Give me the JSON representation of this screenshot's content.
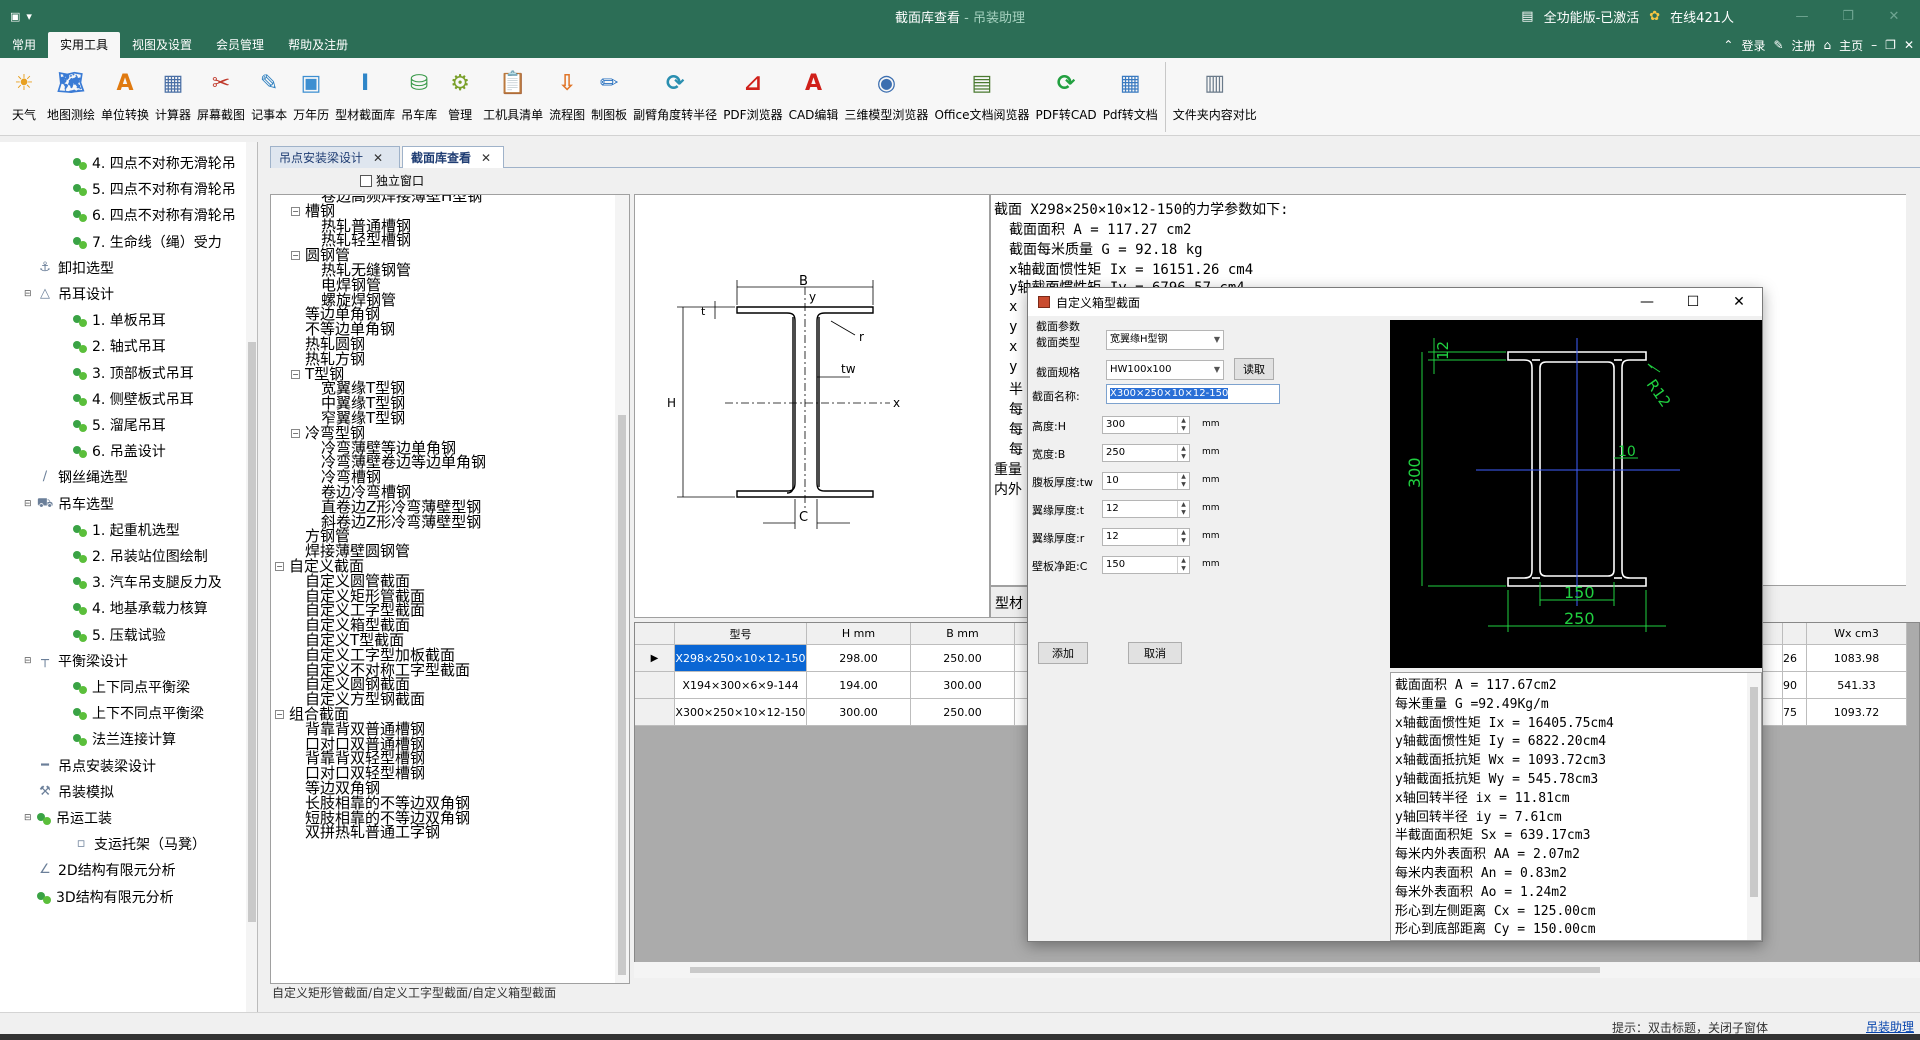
{
  "window": {
    "title": "截面库查看",
    "separator": " - ",
    "app_name": "吊装助理",
    "edition_badge": "全功能版-已激活",
    "online": "在线421人"
  },
  "menu": {
    "tabs": [
      "常用",
      "实用工具",
      "视图及设置",
      "会员管理",
      "帮助及注册"
    ],
    "active_tab": "实用工具",
    "right": {
      "login": "登录",
      "register": "注册",
      "home": "主页"
    }
  },
  "ribbon": {
    "items": [
      {
        "label": "天气",
        "icon": "weather-icon",
        "glyph": "☀",
        "color": "#e8a020"
      },
      {
        "label": "地图测绘",
        "icon": "map-icon",
        "glyph": "🗺",
        "color": "#3a7bd5"
      },
      {
        "label": "单位转换",
        "icon": "unit-convert-icon",
        "glyph": "A",
        "color": "#e07a10"
      },
      {
        "label": "计算器",
        "icon": "calculator-icon",
        "glyph": "▦",
        "color": "#4a6fa5"
      },
      {
        "label": "屏幕截图",
        "icon": "scissors-icon",
        "glyph": "✂",
        "color": "#c0392b"
      },
      {
        "label": "记事本",
        "icon": "notepad-icon",
        "glyph": "✎",
        "color": "#2f80c0"
      },
      {
        "label": "万年历",
        "icon": "calendar-icon",
        "glyph": "▣",
        "color": "#3d8fd1"
      },
      {
        "label": "型材截面库",
        "icon": "i-beam-icon",
        "glyph": "I",
        "color": "#2f86c8"
      },
      {
        "label": "吊车库",
        "icon": "crane-library-icon",
        "glyph": "⛁",
        "color": "#3a9a4a"
      },
      {
        "label": "管理",
        "icon": "manage-icon",
        "glyph": "⚙",
        "color": "#7aa02a"
      },
      {
        "label": "工机具清单",
        "icon": "clipboard-icon",
        "glyph": "📋",
        "color": "#d39a2a"
      },
      {
        "label": "流程图",
        "icon": "flowchart-icon",
        "glyph": "⇩",
        "color": "#e0762a"
      },
      {
        "label": "制图板",
        "icon": "drawing-board-icon",
        "glyph": "✏",
        "color": "#2a72c0"
      },
      {
        "label": "副臂角度转半径",
        "icon": "refresh-icon",
        "glyph": "⟳",
        "color": "#2a8fb0"
      },
      {
        "label": "PDF浏览器",
        "icon": "pdf-icon",
        "glyph": "⊿",
        "color": "#d0201a"
      },
      {
        "label": "CAD编辑",
        "icon": "cad-icon",
        "glyph": "A",
        "color": "#d0201a"
      },
      {
        "label": "三维模型浏览器",
        "icon": "3d-model-icon",
        "glyph": "◉",
        "color": "#3d6fb0"
      },
      {
        "label": "Office文档阅览器",
        "icon": "office-doc-icon",
        "glyph": "▤",
        "color": "#4a7a30"
      },
      {
        "label": "PDF转CAD",
        "icon": "pdf-to-cad-icon",
        "glyph": "⟳",
        "color": "#22a040"
      },
      {
        "label": "Pdf转文档",
        "icon": "pdf-to-doc-icon",
        "glyph": "▦",
        "color": "#3a7ac0"
      },
      {
        "label": "文件夹内容对比",
        "icon": "folder-compare-icon",
        "glyph": "▥",
        "color": "#6a7a8a"
      }
    ]
  },
  "sidebar": {
    "items": [
      {
        "label": "4. 四点不对称无滑轮吊",
        "type": "leaf",
        "level": 2
      },
      {
        "label": "5. 四点不对称有滑轮吊",
        "type": "leaf",
        "level": 2
      },
      {
        "label": "6. 四点不对称有滑轮吊",
        "type": "leaf",
        "level": 2
      },
      {
        "label": "7. 生命线（绳）受力",
        "type": "leaf",
        "level": 2
      },
      {
        "label": "卸扣选型",
        "type": "cat",
        "level": 1,
        "glyph": "⚓"
      },
      {
        "label": "吊耳设计",
        "type": "cat",
        "level": 1,
        "glyph": "△",
        "expanded": true
      },
      {
        "label": "1. 单板吊耳",
        "type": "leaf",
        "level": 2
      },
      {
        "label": "2. 轴式吊耳",
        "type": "leaf",
        "level": 2
      },
      {
        "label": "3. 顶部板式吊耳",
        "type": "leaf",
        "level": 2
      },
      {
        "label": "4. 侧壁板式吊耳",
        "type": "leaf",
        "level": 2
      },
      {
        "label": "5. 溜尾吊耳",
        "type": "leaf",
        "level": 2
      },
      {
        "label": "6. 吊盖设计",
        "type": "leaf",
        "level": 2
      },
      {
        "label": "钢丝绳选型",
        "type": "cat",
        "level": 1,
        "glyph": "∕"
      },
      {
        "label": "吊车选型",
        "type": "cat",
        "level": 1,
        "glyph": "⛟",
        "expanded": true
      },
      {
        "label": "1. 起重机选型",
        "type": "leaf",
        "level": 2
      },
      {
        "label": "2. 吊装站位图绘制",
        "type": "leaf",
        "level": 2
      },
      {
        "label": "3. 汽车吊支腿反力及",
        "type": "leaf",
        "level": 2
      },
      {
        "label": "4. 地基承载力核算",
        "type": "leaf",
        "level": 2
      },
      {
        "label": "5. 压载试验",
        "type": "leaf",
        "level": 2
      },
      {
        "label": "平衡梁设计",
        "type": "cat",
        "level": 1,
        "glyph": "┬",
        "expanded": true
      },
      {
        "label": "上下同点平衡梁",
        "type": "leaf",
        "level": 2
      },
      {
        "label": "上下不同点平衡梁",
        "type": "leaf",
        "level": 2
      },
      {
        "label": "法兰连接计算",
        "type": "leaf",
        "level": 2
      },
      {
        "label": "吊点安装梁设计",
        "type": "cat",
        "level": 1,
        "glyph": "━"
      },
      {
        "label": "吊装模拟",
        "type": "cat",
        "level": 1,
        "glyph": "⚒"
      },
      {
        "label": "吊运工装",
        "type": "leaf",
        "level": 1,
        "expanded": true
      },
      {
        "label": "支运托架（马凳）",
        "type": "cat",
        "level": 2,
        "glyph": "▫"
      },
      {
        "label": "2D结构有限元分析",
        "type": "cat",
        "level": 1,
        "glyph": "∠"
      },
      {
        "label": "3D结构有限元分析",
        "type": "leaf",
        "level": 1
      }
    ]
  },
  "doc_tabs": [
    {
      "label": "吊点安装梁设计",
      "active": false
    },
    {
      "label": "截面库查看",
      "active": true
    }
  ],
  "independent_window": "独立窗口",
  "section_tree": {
    "items": [
      {
        "label": "卷边高频焊接薄壁H型钢",
        "level": 3
      },
      {
        "label": "槽钢",
        "level": 2,
        "expander": "−"
      },
      {
        "label": "热轧普通槽钢",
        "level": 3
      },
      {
        "label": "热轧轻型槽钢",
        "level": 3
      },
      {
        "label": "圆钢管",
        "level": 2,
        "expander": "−"
      },
      {
        "label": "热轧无缝钢管",
        "level": 3
      },
      {
        "label": "电焊钢管",
        "level": 3
      },
      {
        "label": "螺旋焊钢管",
        "level": 3
      },
      {
        "label": "等边单角钢",
        "level": 2
      },
      {
        "label": "不等边单角钢",
        "level": 2
      },
      {
        "label": "热轧圆钢",
        "level": 2
      },
      {
        "label": "热轧方钢",
        "level": 2
      },
      {
        "label": "T型钢",
        "level": 2,
        "expander": "−"
      },
      {
        "label": "宽翼缘T型钢",
        "level": 3
      },
      {
        "label": "中翼缘T型钢",
        "level": 3
      },
      {
        "label": "窄翼缘T型钢",
        "level": 3
      },
      {
        "label": "冷弯型钢",
        "level": 2,
        "expander": "−"
      },
      {
        "label": "冷弯薄壁等边单角钢",
        "level": 3
      },
      {
        "label": "冷弯薄壁卷边等边单角钢",
        "level": 3
      },
      {
        "label": "冷弯槽钢",
        "level": 3
      },
      {
        "label": "卷边冷弯槽钢",
        "level": 3
      },
      {
        "label": "直卷边Z形冷弯薄壁型钢",
        "level": 3
      },
      {
        "label": "斜卷边Z形冷弯薄壁型钢",
        "level": 3
      },
      {
        "label": "方钢管",
        "level": 2
      },
      {
        "label": "焊接薄壁圆钢管",
        "level": 2
      },
      {
        "label": "自定义截面",
        "level": 1,
        "expander": "−"
      },
      {
        "label": "自定义圆管截面",
        "level": 2
      },
      {
        "label": "自定义矩形管截面",
        "level": 2
      },
      {
        "label": "自定义工字型截面",
        "level": 2
      },
      {
        "label": "自定义箱型截面",
        "level": 2
      },
      {
        "label": "自定义T型截面",
        "level": 2
      },
      {
        "label": "自定义工字型加板截面",
        "level": 2
      },
      {
        "label": "自定义不对称工字型截面",
        "level": 2
      },
      {
        "label": "自定义圆钢截面",
        "level": 2
      },
      {
        "label": "自定义方型钢截面",
        "level": 2
      },
      {
        "label": "组合截面",
        "level": 1,
        "expander": "−"
      },
      {
        "label": "背靠背双普通槽钢",
        "level": 2
      },
      {
        "label": "口对口双普通槽钢",
        "level": 2
      },
      {
        "label": "背靠背双轻型槽钢",
        "level": 2
      },
      {
        "label": "口对口双轻型槽钢",
        "level": 2
      },
      {
        "label": "等边双角钢",
        "level": 2
      },
      {
        "label": "长肢相靠的不等边双角钢",
        "level": 2
      },
      {
        "label": "短肢相靠的不等边双角钢",
        "level": 2
      },
      {
        "label": "双拼热轧普通工字钢",
        "level": 2
      }
    ]
  },
  "status_path": "自定义矩形管截面/自定义工字型截面/自定义箱型截面",
  "section_drawing": {
    "B": "B",
    "y": "y",
    "t": "t",
    "r": "r",
    "tw": "tw",
    "H": "H",
    "x": "x",
    "C": "C"
  },
  "params": {
    "header": "截面 X298×250×10×12-150的力学参数如下:",
    "lines": [
      "截面面积 A = 117.27 cm2",
      "截面每米质量 G = 92.18 kg",
      "x轴截面惯性矩 Ix = 16151.26 cm4",
      "y轴截面惯性矩 Iy = 6796.57 cm4"
    ],
    "fragments": [
      "x",
      "y",
      "x",
      "y",
      "半",
      "每",
      "每",
      "每"
    ],
    "fragments2": [
      "重量",
      "内外"
    ],
    "tab_label": "型材"
  },
  "grid": {
    "columns": [
      "型号",
      "H mm",
      "B mm"
    ],
    "right_columns": [
      "Wx cm3"
    ],
    "rows": [
      {
        "model": "X298×250×10×12-150",
        "H": "298.00",
        "B": "250.00",
        "frag": "26",
        "Wx": "1083.98",
        "selected": true
      },
      {
        "model": "X194×300×6×9-144",
        "H": "194.00",
        "B": "300.00",
        "frag": "90",
        "Wx": "541.33",
        "selected": false
      },
      {
        "model": "X300×250×10×12-150",
        "H": "300.00",
        "B": "250.00",
        "frag": "75",
        "Wx": "1093.72",
        "selected": false
      }
    ],
    "current_row_marker": "▶"
  },
  "dialog": {
    "title": "自定义箱型截面",
    "section_params_label": "截面参数",
    "type_label": "截面类型",
    "type_value": "宽翼缘H型钢",
    "spec_label": "截面规格",
    "spec_value": "HW100x100",
    "read_button": "读取",
    "name_label": "截面名称:",
    "name_value": "X300×250×10×12-150",
    "fields": [
      {
        "label": "高度:H",
        "value": "300",
        "unit": "mm"
      },
      {
        "label": "宽度:B",
        "value": "250",
        "unit": "mm"
      },
      {
        "label": "腹板厚度:tw",
        "value": "10",
        "unit": "mm"
      },
      {
        "label": "翼缘厚度:t",
        "value": "12",
        "unit": "mm"
      },
      {
        "label": "翼缘厚度:r",
        "value": "12",
        "unit": "mm"
      },
      {
        "label": "壁板净距:C",
        "value": "150",
        "unit": "mm"
      }
    ],
    "add_button": "添加",
    "cancel_button": "取消",
    "preview": {
      "t_dim": "12",
      "r_dim": "R12",
      "h_dim": "300",
      "tw_dim": "10",
      "c_dim": "150",
      "b_dim": "250"
    },
    "results": [
      "截面面积 A = 117.67cm2",
      "每米重量 G =92.49Kg/m",
      "x轴截面惯性矩 Ix = 16405.75cm4",
      "y轴截面惯性矩 Iy = 6822.20cm4",
      "x轴截面抵抗矩 Wx = 1093.72cm3",
      "y轴截面抵抗矩 Wy = 545.78cm3",
      "x轴回转半径 ix = 11.81cm",
      "y轴回转半径 iy = 7.61cm",
      "半截面面积矩 Sx =  639.17cm3",
      "每米内外表面积 AA =  2.07m2",
      "每米内表面积 An =  0.83m2",
      "每米外表面积 Ao =  1.24m2",
      "形心到左侧距离 Cx = 125.00cm",
      "形心到底部距离 Cy = 150.00cm"
    ]
  },
  "statusbar": {
    "hint": "提示：双击标题，关闭子窗体",
    "link": "吊装助理"
  }
}
